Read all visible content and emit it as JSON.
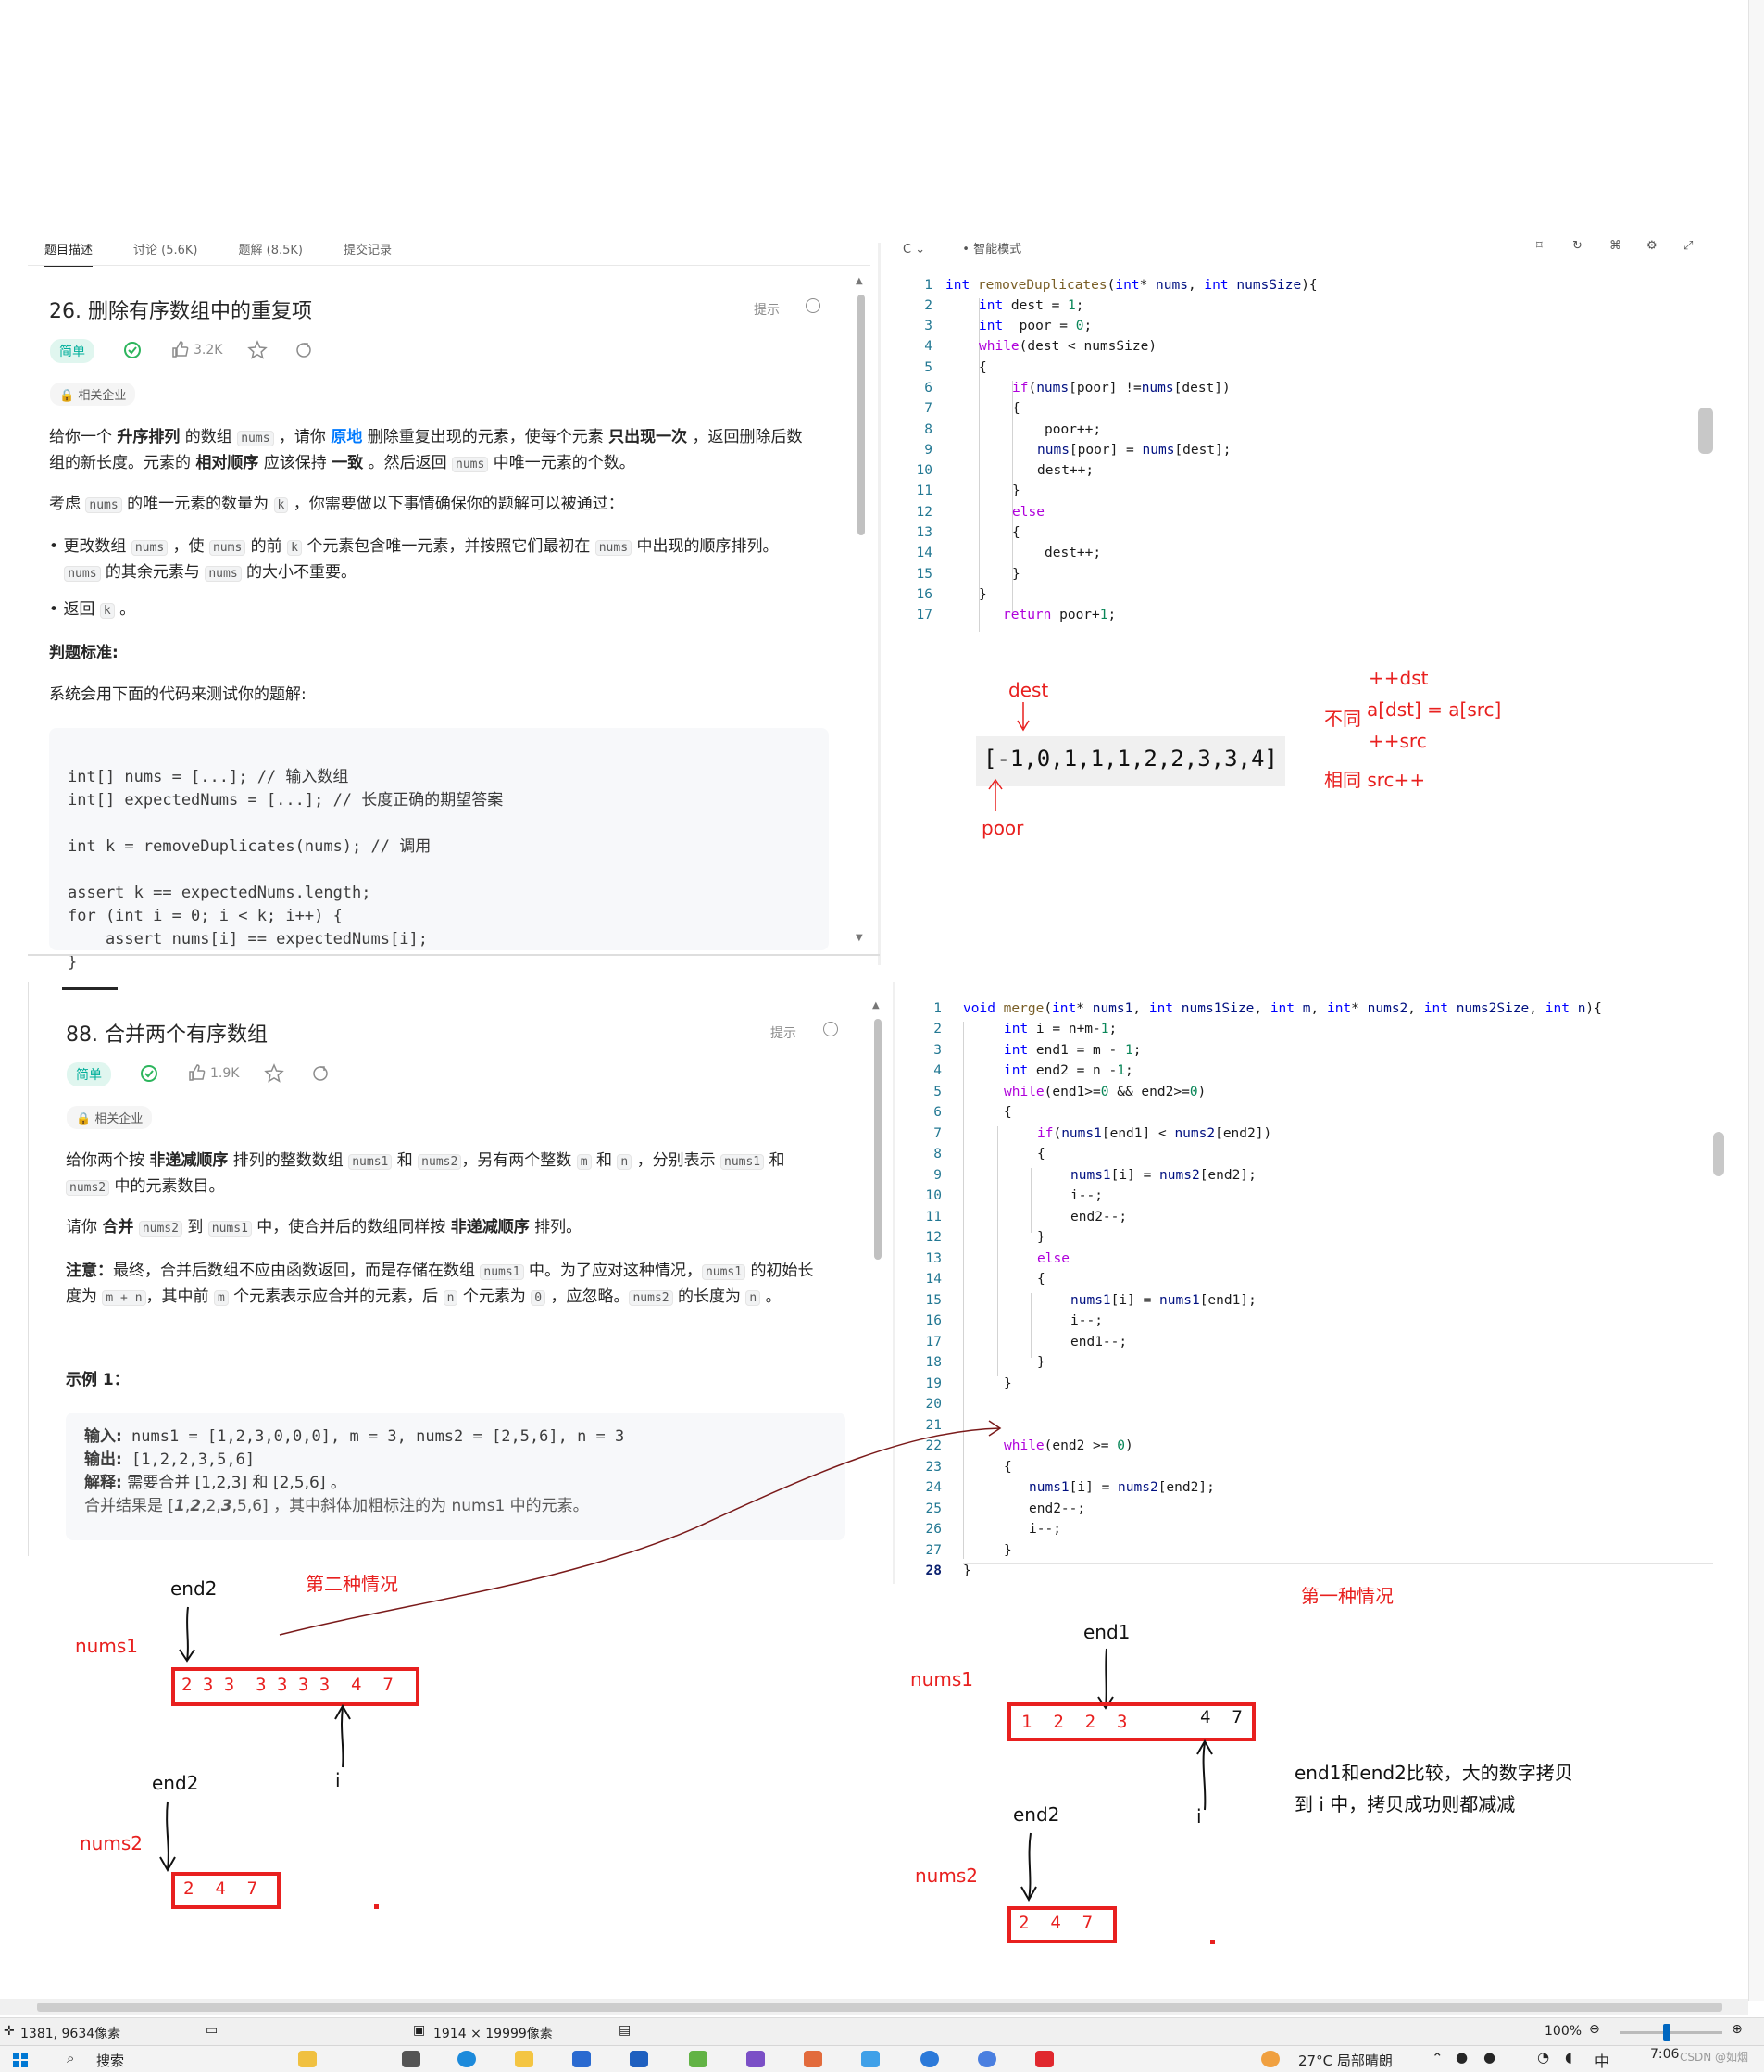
{
  "problem1": {
    "tabs": [
      "题目描述",
      "讨论 (5.6K)",
      "题解 (8.5K)",
      "提交记录"
    ],
    "title": "26. 删除有序数组中的重复项",
    "hint": "提示",
    "difficulty": "简单",
    "likes": "3.2K",
    "company": "相关企业",
    "desc1": {
      "a": "给你一个 ",
      "b": "升序排列",
      "c": " 的数组 ",
      "d": "nums",
      "e": " ，请你 ",
      "f": "原地",
      "g": " 删除重复出现的元素，使每个元素 ",
      "h": "只出现一次",
      "i": " ，返回删除后数",
      "j": "组的新长度。元素的 ",
      "k": "相对顺序",
      "l": " 应该保持 ",
      "m": "一致",
      "n": " 。然后返回 ",
      "o": "nums",
      "p": " 中唯一元素的个数。"
    },
    "desc2": {
      "a": "考虑 ",
      "b": "nums",
      "c": " 的唯一元素的数量为 ",
      "d": "k",
      "e": " ，你需要做以下事情确保你的题解可以被通过："
    },
    "bullet1": {
      "a": "更改数组 ",
      "b": "nums",
      "c": " ，使 ",
      "d": "nums",
      "e": " 的前 ",
      "f": "k",
      "g": " 个元素包含唯一元素，并按照它们最初在 ",
      "h": "nums",
      "i": " 中出现的顺序排列。",
      "j": "nums",
      "k": " 的其余元素与 ",
      "l": "nums",
      "m": " 的大小不重要。"
    },
    "bullet2": {
      "a": "返回 ",
      "b": "k",
      "c": " 。"
    },
    "judge_title": "判题标准:",
    "judge_text": "系统会用下面的代码来测试你的题解:",
    "code": [
      "int[] nums = [...]; // 输入数组",
      "int[] expectedNums = [...]; // 长度正确的期望答案",
      "",
      "int k = removeDuplicates(nums); // 调用",
      "",
      "assert k == expectedNums.length;",
      "for (int i = 0; i < k; i++) {",
      "    assert nums[i] == expectedNums[i];",
      "}"
    ]
  },
  "editor1": {
    "lang": "C",
    "mode": "智能模式",
    "line_numbers": [
      "1",
      "2",
      "3",
      "4",
      "5",
      "6",
      "7",
      "8",
      "9",
      "10",
      "11",
      "12",
      "13",
      "14",
      "15",
      "16",
      "17"
    ]
  },
  "problem2": {
    "title": "88. 合并两个有序数组",
    "hint": "提示",
    "difficulty": "简单",
    "likes": "1.9K",
    "company": "相关企业",
    "desc1": {
      "a": "给你两个按 ",
      "b": "非递减顺序",
      "c": " 排列的整数数组 ",
      "d": "nums1",
      "e": " 和 ",
      "f": "nums2",
      "g": "，另有两个整数 ",
      "h": "m",
      "i": " 和 ",
      "j": "n",
      "k": " ，分别表示 ",
      "l": "nums1",
      "m": " 和",
      "n": "nums2",
      "o": " 中的元素数目。"
    },
    "desc2": {
      "a": "请你 ",
      "b": "合并",
      "c": " ",
      "d": "nums2",
      "e": " 到 ",
      "f": "nums1",
      "g": " 中，使合并后的数组同样按 ",
      "h": "非递减顺序",
      "i": " 排列。"
    },
    "desc3": {
      "a": "注意：",
      "b": "最终，合并后数组不应由函数返回，而是存储在数组 ",
      "c": "nums1",
      "d": " 中。为了应对这种情况，",
      "e": "nums1",
      "f": " 的初始长",
      "g": "度为 ",
      "h": "m + n",
      "i": "，其中前 ",
      "j": "m",
      "k": " 个元素表示应合并的元素，后 ",
      "l": "n",
      "m": " 个元素为 ",
      "n": "0",
      "o": " ，应忽略。",
      "p": "nums2",
      "q": " 的长度为 ",
      "r": "n",
      "s": " 。"
    },
    "example_title": "示例 1：",
    "example": {
      "in_label": "输入:",
      "in_text": " nums1 = [1,2,3,0,0,0], m = 3, nums2 = [2,5,6], n = 3",
      "out_label": "输出:",
      "out_text": " [1,2,2,3,5,6]",
      "exp_label": "解释:",
      "exp_text": " 需要合并 [1,2,3] 和 [2,5,6] 。",
      "merge_a": "合并结果是 [",
      "merge_b": "1",
      "merge_c": ",",
      "merge_d": "2",
      "merge_e": ",2,",
      "merge_f": "3",
      "merge_g": ",5,6] ，其中斜体加粗标注的为 nums1 中的元素。"
    }
  },
  "editor2": {
    "line_numbers": [
      "1",
      "2",
      "3",
      "4",
      "5",
      "6",
      "7",
      "8",
      "9",
      "10",
      "11",
      "12",
      "13",
      "14",
      "15",
      "16",
      "17",
      "18",
      "19",
      "20",
      "21",
      "22",
      "23",
      "24",
      "25",
      "26",
      "27",
      "28"
    ]
  },
  "annotations1": {
    "dest": "dest",
    "poor": "poor",
    "array": "[-1,0,1,1,1,2,2,3,3,4]",
    "inc_dst": "++dst",
    "diff": "不同",
    "assign": "a[dst] = a[src]",
    "inc_src": "++src",
    "same": "相同 src++"
  },
  "annotations2": {
    "case2": "第二种情况",
    "case1": "第一种情况",
    "end2_a": "end2",
    "nums1_a": "nums1",
    "nums1_a_values": "2 3 3  3 3 3 3  4  7",
    "i_a": "i",
    "end2_b": "end2",
    "nums2_a": "nums2",
    "nums2_a_values": "2  4  7",
    "end1": "end1",
    "nums1_b": "nums1",
    "nums1_b_values_left": "1  2  2  3",
    "nums1_b_values_right": "4  7",
    "i_b": "i",
    "explain1": "end1和end2比较，大的数字拷贝",
    "explain2": "到 i 中，拷贝成功则都减减",
    "end2_c": "end2",
    "nums2_b": "nums2",
    "nums2_b_values": "2  4  7"
  },
  "statusbar": {
    "coords": "1381, 9634像素",
    "size": "1914 × 19999像素",
    "zoom": "100%"
  },
  "taskbar": {
    "search": "搜索",
    "weather": "27°C  局部晴朗",
    "ime": "中",
    "time": "7:06",
    "watermark": "CSDN @如烟"
  }
}
